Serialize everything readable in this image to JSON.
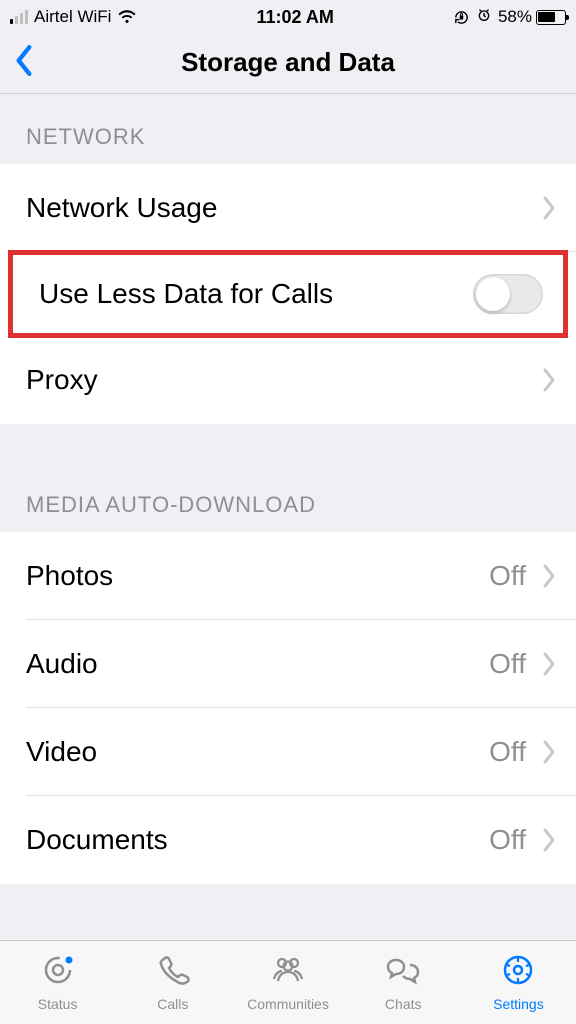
{
  "statusBar": {
    "carrier": "Airtel WiFi",
    "time": "11:02 AM",
    "batteryPct": "58%"
  },
  "nav": {
    "title": "Storage and Data"
  },
  "sections": {
    "network": {
      "header": "NETWORK",
      "networkUsage": "Network Usage",
      "useLessData": "Use Less Data for Calls",
      "proxy": "Proxy"
    },
    "media": {
      "header": "MEDIA AUTO-DOWNLOAD",
      "photos": {
        "label": "Photos",
        "value": "Off"
      },
      "audio": {
        "label": "Audio",
        "value": "Off"
      },
      "video": {
        "label": "Video",
        "value": "Off"
      },
      "documents": {
        "label": "Documents",
        "value": "Off"
      }
    }
  },
  "tabs": {
    "status": "Status",
    "calls": "Calls",
    "communities": "Communities",
    "chats": "Chats",
    "settings": "Settings"
  }
}
